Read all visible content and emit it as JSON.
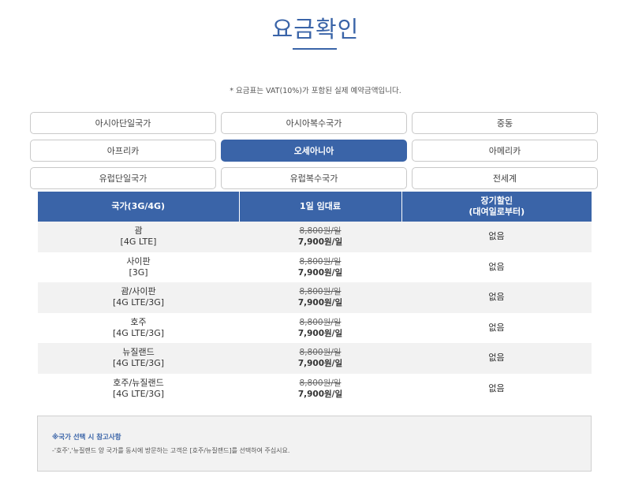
{
  "page": {
    "title": "요금확인",
    "notice": "* 요금표는 VAT(10%)가 포함된 실제 예약금액입니다."
  },
  "regions": [
    {
      "label": "아시아단일국가",
      "active": false
    },
    {
      "label": "아시아복수국가",
      "active": false
    },
    {
      "label": "중동",
      "active": false
    },
    {
      "label": "아프리카",
      "active": false
    },
    {
      "label": "오세아니아",
      "active": true
    },
    {
      "label": "아메리카",
      "active": false
    },
    {
      "label": "유럽단일국가",
      "active": false
    },
    {
      "label": "유럽복수국가",
      "active": false
    },
    {
      "label": "전세계",
      "active": false
    }
  ],
  "table": {
    "headers": {
      "country": "국가(3G/4G)",
      "rate": "1일 임대료",
      "discount_line1": "장기할인",
      "discount_line2": "(대여일로부터)"
    },
    "rows": [
      {
        "country": "괌",
        "network": "[4G LTE]",
        "old_price": "8,800원/일",
        "new_price": "7,900원/일",
        "discount": "없음"
      },
      {
        "country": "사이판",
        "network": "[3G]",
        "old_price": "8,800원/일",
        "new_price": "7,900원/일",
        "discount": "없음"
      },
      {
        "country": "괌/사이판",
        "network": "[4G LTE/3G]",
        "old_price": "8,800원/일",
        "new_price": "7,900원/일",
        "discount": "없음"
      },
      {
        "country": "호주",
        "network": "[4G LTE/3G]",
        "old_price": "8,800원/일",
        "new_price": "7,900원/일",
        "discount": "없음"
      },
      {
        "country": "뉴질랜드",
        "network": "[4G LTE/3G]",
        "old_price": "8,800원/일",
        "new_price": "7,900원/일",
        "discount": "없음"
      },
      {
        "country": "호주/뉴질랜드",
        "network": "[4G LTE/3G]",
        "old_price": "8,800원/일",
        "new_price": "7,900원/일",
        "discount": "없음"
      }
    ]
  },
  "note": {
    "title": "※국가 선택 시 참고사항",
    "text": "-'호주','뉴질랜드 양 국가를 동시에 방문하는 고객은 [호주/뉴질랜드]를 선택하여 주십시요."
  },
  "colors": {
    "accent": "#3a64a8",
    "row_alt": "#f2f2f2"
  }
}
